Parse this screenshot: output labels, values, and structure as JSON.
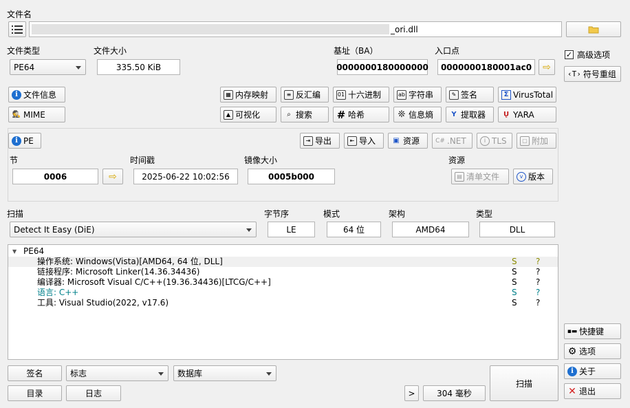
{
  "file": {
    "label": "文件名",
    "path_suffix": "_ori.dll",
    "folder_icon": "folder-icon"
  },
  "filetype": {
    "label": "文件类型",
    "value": "PE64"
  },
  "filesize": {
    "label": "文件大小",
    "value": "335.50 KiB"
  },
  "base": {
    "label": "基址（BA）",
    "value": "0000000180000000"
  },
  "entry": {
    "label": "入口点",
    "value": "0000000180001ac0"
  },
  "side": {
    "advanced_label": "高级选项",
    "advanced_checked": true,
    "symbol_label": "符号重组",
    "shortcut_label": "快捷键",
    "options_label": "选项",
    "about_label": "关于",
    "exit_label": "退出"
  },
  "tools": {
    "fileinfo": "文件信息",
    "mime": "MIME",
    "memmap": "内存映射",
    "disasm": "反汇编",
    "hex": "十六进制",
    "strings": "字符串",
    "signature": "签名",
    "virustotal": "VirusTotal",
    "visualize": "可视化",
    "search": "搜索",
    "hash": "哈希",
    "entropy": "信息熵",
    "extractor": "提取器",
    "yara": "YARA"
  },
  "pe": {
    "label": "PE",
    "export": "导出",
    "import": "导入",
    "resources": "资源",
    "net": ".NET",
    "tls": "TLS",
    "overlay": "附加",
    "sections_label": "节",
    "sections_value": "0006",
    "timestamp_label": "时间戳",
    "timestamp_value": "2025-06-22 10:02:56",
    "imagesize_label": "镜像大小",
    "imagesize_value": "0005b000",
    "resources_label": "资源",
    "manifest": "清单文件",
    "version": "版本"
  },
  "scan": {
    "label": "扫描",
    "engine": "Detect It Easy (DiE)",
    "endian_label": "字节序",
    "endian": "LE",
    "mode_label": "模式",
    "mode": "64 位",
    "arch_label": "架构",
    "arch": "AMD64",
    "type_label": "类型",
    "type": "DLL"
  },
  "results": {
    "root": "PE64",
    "items": [
      {
        "text": "操作系统: Windows(Vista)[AMD64, 64 位, DLL]",
        "s": "S",
        "q": "?",
        "color": "#000000",
        "s_color": "#8a8a00",
        "q_color": "#8a8a00"
      },
      {
        "text": "链接程序: Microsoft Linker(14.36.34436)",
        "s": "S",
        "q": "?",
        "color": "#000000",
        "s_color": "#000000",
        "q_color": "#000000"
      },
      {
        "text": "编译器: Microsoft Visual C/C++(19.36.34436)[LTCG/C++]",
        "s": "S",
        "q": "?",
        "color": "#000000",
        "s_color": "#000000",
        "q_color": "#000000"
      },
      {
        "text": "语言: C++",
        "s": "S",
        "q": "?",
        "color": "#00808a",
        "s_color": "#00808a",
        "q_color": "#00808a"
      },
      {
        "text": "工具: Visual Studio(2022, v17.6)",
        "s": "S",
        "q": "?",
        "color": "#000000",
        "s_color": "#000000",
        "q_color": "#000000"
      }
    ]
  },
  "bottom": {
    "signature": "签名",
    "flags": "标志",
    "database": "数据库",
    "dir": "目录",
    "log": "日志",
    "more": ">",
    "elapsed": "304 毫秒",
    "scan": "扫描"
  }
}
